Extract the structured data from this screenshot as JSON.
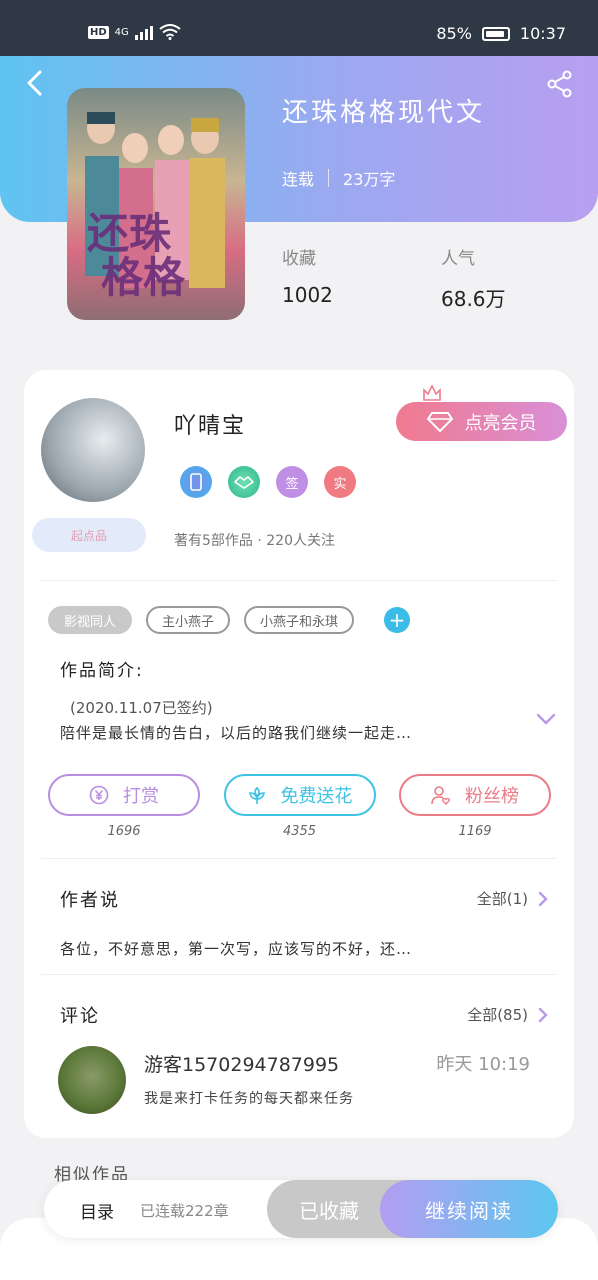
{
  "status_bar": {
    "hd": "HD",
    "network": "4G",
    "battery_percent": "85%",
    "time": "10:37"
  },
  "book": {
    "title": "还珠格格现代文",
    "status": "连载",
    "word_count": "23万字",
    "favorites_label": "收藏",
    "favorites_value": "1002",
    "popularity_label": "人气",
    "popularity_value": "68.6万"
  },
  "author": {
    "name": "吖晴宝",
    "vip_button": "点亮会员",
    "badges": [
      "签",
      "实"
    ],
    "rank_badge": "起点品",
    "works_info": "著有5部作品 · 220人关注"
  },
  "tags": [
    "影视同人",
    "主小燕子",
    "小燕子和永琪"
  ],
  "intro": {
    "title": "作品简介:",
    "date": "(2020.11.07已签约)",
    "text": "陪伴是最长情的告白，以后的路我们继续一起走…"
  },
  "actions": [
    {
      "label": "打赏",
      "count": "1696",
      "color": "#b98ee0"
    },
    {
      "label": "免费送花",
      "count": "4355",
      "color": "#3ec3e4"
    },
    {
      "label": "粉丝榜",
      "count": "1169",
      "color": "#ec7b86"
    }
  ],
  "author_says": {
    "title": "作者说",
    "more": "全部(1)",
    "text": "各位，不好意思，第一次写，应该写的不好，还…"
  },
  "comments": {
    "title": "评论",
    "more": "全部(85)",
    "user": "游客1570294787995",
    "time": "昨天 10:19",
    "text": "我是来打卡任务的每天都来任务"
  },
  "similar_title": "相似作品",
  "bottom_bar": {
    "toc": "目录",
    "chapters": "已连载222章",
    "collected": "已收藏",
    "continue": "继续阅读"
  }
}
